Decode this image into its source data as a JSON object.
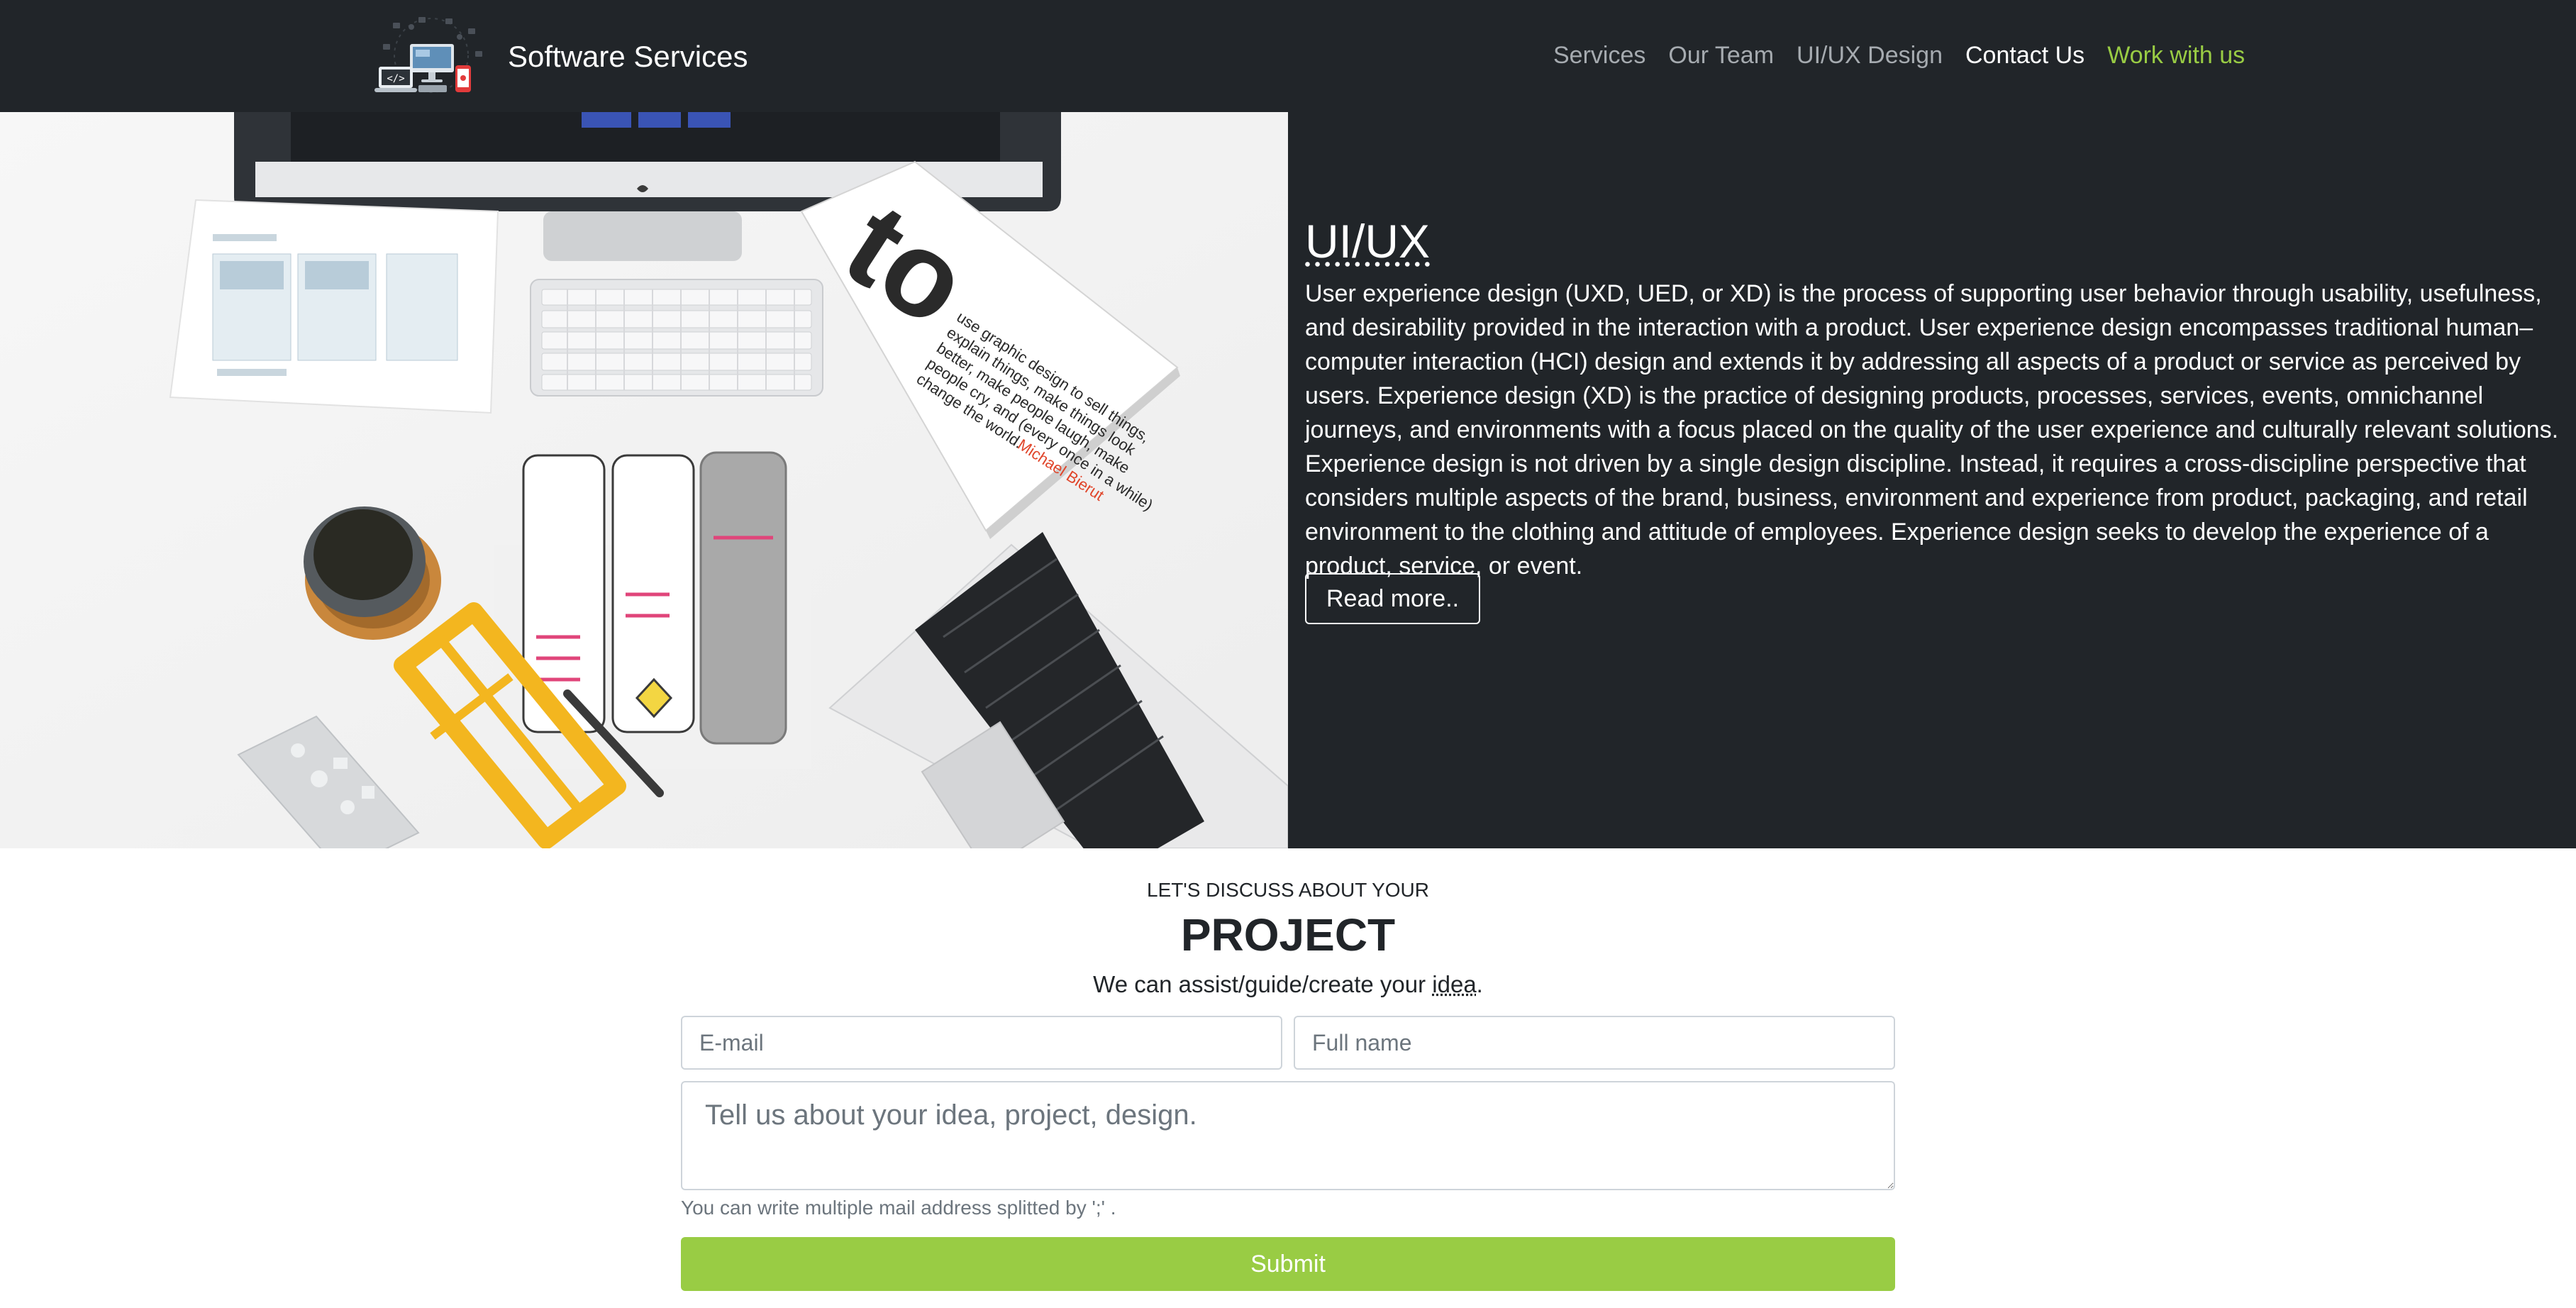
{
  "colors": {
    "navbar_bg": "#212529",
    "accent": "#99cc44",
    "nav_muted": "#a6abb0",
    "text_light": "#ffffff"
  },
  "brand": {
    "name": "Software Services",
    "logo_icon": "devices-code-logo-icon"
  },
  "nav": {
    "items": [
      {
        "label": "Services"
      },
      {
        "label": "Our Team"
      },
      {
        "label": "UI/UX Design"
      },
      {
        "label": "Contact Us"
      },
      {
        "label": "Work with us"
      }
    ],
    "active_index": 3
  },
  "hero": {
    "title": "UI/UX",
    "description": "User experience design (UXD, UED, or XD) is the process of supporting user behavior through usability, usefulness, and desirability provided in the interaction with a product. User experience design encompasses traditional human–computer interaction (HCI) design and extends it by addressing all aspects of a product or service as perceived by users. Experience design (XD) is the practice of designing products, processes, services, events, omnichannel journeys, and environments with a focus placed on the quality of the user experience and culturally relevant solutions. Experience design is not driven by a single design discipline. Instead, it requires a cross-discipline perspective that considers multiple aspects of the brand, business, environment and experience from product, packaging, and retail environment to the clothing and attitude of employees. Experience design seeks to develop the experience of a product, service, or event.",
    "button_label": "Read more..",
    "image": {
      "book_lines": [
        "use graphic design to sell things,",
        "explain things, make things look",
        "better, make people laugh, make",
        "people cry, and (every once in a while)",
        "change the world."
      ],
      "book_author": "Michael Bierut",
      "book_big": "to"
    }
  },
  "contact": {
    "eyebrow": "LET'S DISCUSS ABOUT YOUR",
    "title": "PROJECT",
    "tagline_prefix": "We can assist/guide/create your ",
    "tagline_abbr": "idea",
    "tagline_suffix": ".",
    "email_placeholder": "E-mail",
    "fullname_placeholder": "Full name",
    "message_placeholder": "Tell us about your idea, project, design.",
    "help_text": "You can write multiple mail address splitted by ';' .",
    "submit_label": "Submit"
  }
}
